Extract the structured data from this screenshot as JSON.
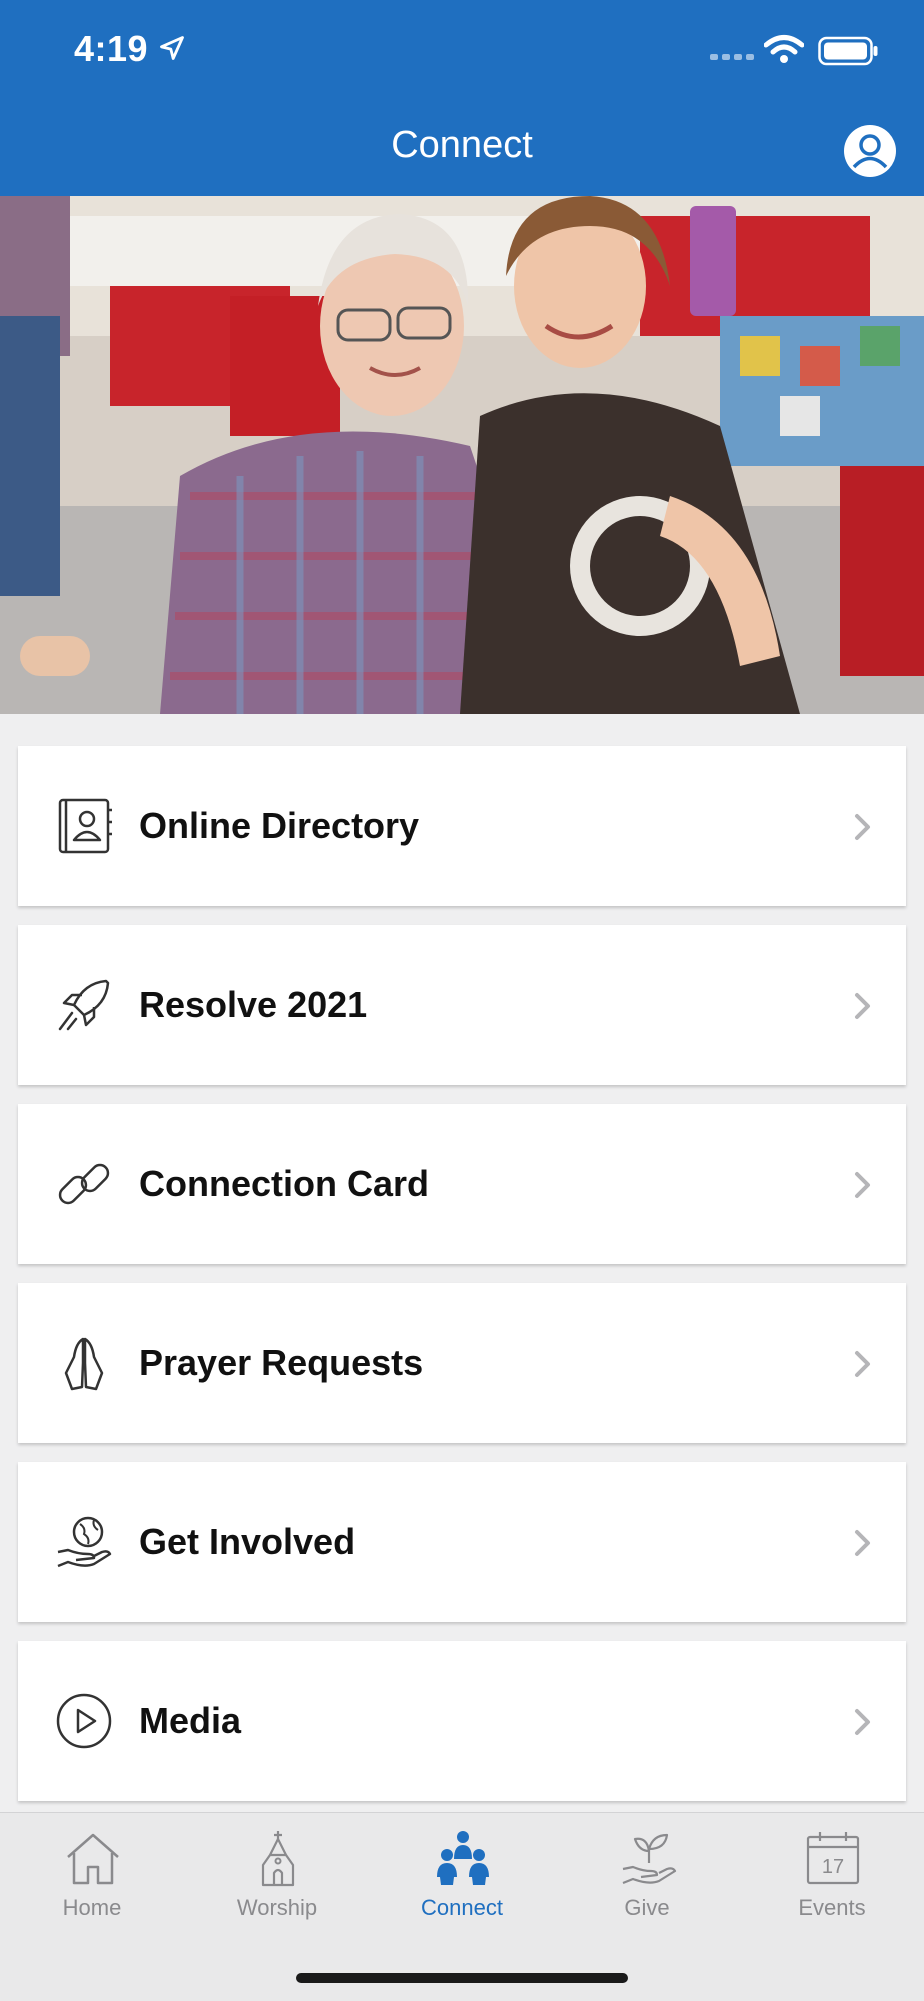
{
  "status_bar": {
    "time": "4:19"
  },
  "header": {
    "title": "Connect"
  },
  "menu": [
    {
      "label": "Online Directory",
      "icon": "directory-icon"
    },
    {
      "label": "Resolve 2021",
      "icon": "rocket-icon"
    },
    {
      "label": "Connection Card",
      "icon": "link-icon"
    },
    {
      "label": "Prayer Requests",
      "icon": "praying-hands-icon"
    },
    {
      "label": "Get Involved",
      "icon": "globe-hand-icon"
    },
    {
      "label": "Media",
      "icon": "play-icon"
    }
  ],
  "tabs": [
    {
      "label": "Home",
      "icon": "home-icon",
      "active": false
    },
    {
      "label": "Worship",
      "icon": "church-icon",
      "active": false
    },
    {
      "label": "Connect",
      "icon": "people-icon",
      "active": true
    },
    {
      "label": "Give",
      "icon": "plant-hand-icon",
      "active": false
    },
    {
      "label": "Events",
      "icon": "calendar-icon",
      "calendar_day": "17",
      "active": false
    }
  ],
  "colors": {
    "brand": "#1f6fc0",
    "tab_inactive": "#8a8a8d",
    "background": "#efeff0"
  }
}
